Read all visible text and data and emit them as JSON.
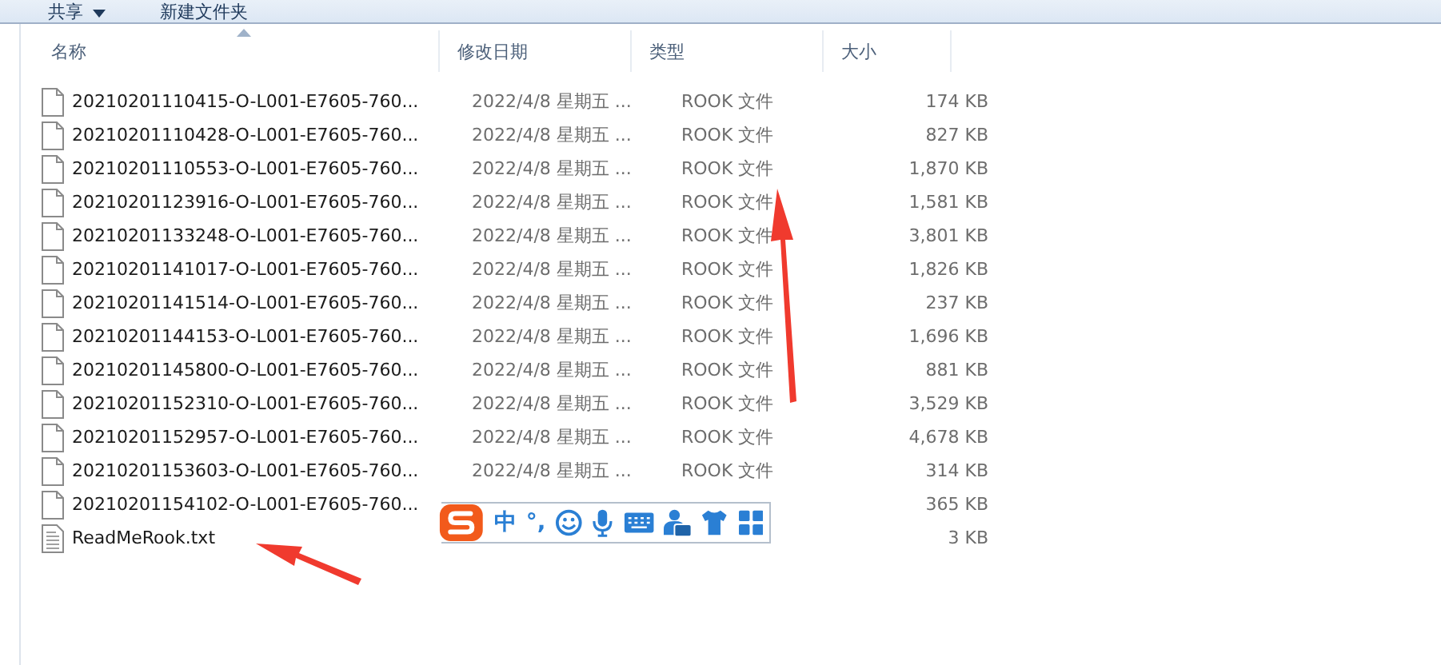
{
  "toolbar": {
    "items": [
      {
        "label": "共享",
        "dropdown": true
      },
      {
        "label": "新建文件夹",
        "dropdown": false
      }
    ]
  },
  "columns": [
    {
      "label": "名称",
      "sorted": true
    },
    {
      "label": "修改日期",
      "sorted": false
    },
    {
      "label": "类型",
      "sorted": false
    },
    {
      "label": "大小",
      "sorted": false
    }
  ],
  "files": [
    {
      "name": "20210201110415-O-L001-E7605-760...",
      "kind": "file",
      "date": "2022/4/8 星期五 ...",
      "type": "ROOK 文件",
      "size": "174 KB"
    },
    {
      "name": "20210201110428-O-L001-E7605-760...",
      "kind": "file",
      "date": "2022/4/8 星期五 ...",
      "type": "ROOK 文件",
      "size": "827 KB"
    },
    {
      "name": "20210201110553-O-L001-E7605-760...",
      "kind": "file",
      "date": "2022/4/8 星期五 ...",
      "type": "ROOK 文件",
      "size": "1,870 KB"
    },
    {
      "name": "20210201123916-O-L001-E7605-760...",
      "kind": "file",
      "date": "2022/4/8 星期五 ...",
      "type": "ROOK 文件",
      "size": "1,581 KB"
    },
    {
      "name": "20210201133248-O-L001-E7605-760...",
      "kind": "file",
      "date": "2022/4/8 星期五 ...",
      "type": "ROOK 文件",
      "size": "3,801 KB"
    },
    {
      "name": "20210201141017-O-L001-E7605-760...",
      "kind": "file",
      "date": "2022/4/8 星期五 ...",
      "type": "ROOK 文件",
      "size": "1,826 KB"
    },
    {
      "name": "20210201141514-O-L001-E7605-760...",
      "kind": "file",
      "date": "2022/4/8 星期五 ...",
      "type": "ROOK 文件",
      "size": "237 KB"
    },
    {
      "name": "20210201144153-O-L001-E7605-760...",
      "kind": "file",
      "date": "2022/4/8 星期五 ...",
      "type": "ROOK 文件",
      "size": "1,696 KB"
    },
    {
      "name": "20210201145800-O-L001-E7605-760...",
      "kind": "file",
      "date": "2022/4/8 星期五 ...",
      "type": "ROOK 文件",
      "size": "881 KB"
    },
    {
      "name": "20210201152310-O-L001-E7605-760...",
      "kind": "file",
      "date": "2022/4/8 星期五 ...",
      "type": "ROOK 文件",
      "size": "3,529 KB"
    },
    {
      "name": "20210201152957-O-L001-E7605-760...",
      "kind": "file",
      "date": "2022/4/8 星期五 ...",
      "type": "ROOK 文件",
      "size": "4,678 KB"
    },
    {
      "name": "20210201153603-O-L001-E7605-760...",
      "kind": "file",
      "date": "2022/4/8 星期五 ...",
      "type": "ROOK 文件",
      "size": "314 KB"
    },
    {
      "name": "20210201154102-O-L001-E7605-760...",
      "kind": "file",
      "size": "365 KB"
    },
    {
      "name": "ReadMeRook.txt",
      "kind": "text",
      "size": "3 KB"
    }
  ],
  "ime_toolbar": {
    "items": [
      {
        "kind": "logo"
      },
      {
        "kind": "text",
        "label": "中"
      },
      {
        "kind": "text",
        "label": "°,"
      },
      {
        "kind": "smiley"
      },
      {
        "kind": "mic"
      },
      {
        "kind": "keyboard"
      },
      {
        "kind": "person"
      },
      {
        "kind": "shirt"
      },
      {
        "kind": "grid"
      }
    ]
  }
}
